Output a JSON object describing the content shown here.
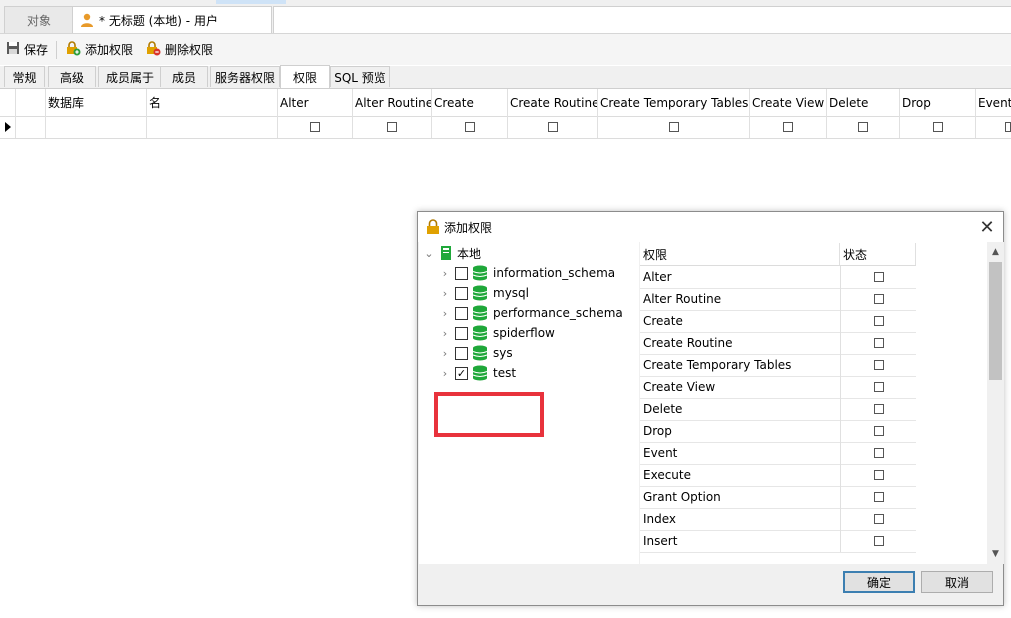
{
  "doc_tabs": [
    {
      "label": "对象"
    },
    {
      "label": "* 无标题 (本地) - 用户"
    }
  ],
  "toolbar": {
    "save_label": "保存",
    "add_priv_label": "添加权限",
    "del_priv_label": "删除权限"
  },
  "prop_tabs": [
    "常规",
    "高级",
    "成员属于",
    "成员",
    "服务器权限",
    "权限",
    "SQL 预览"
  ],
  "grid": {
    "headers": [
      "数据库",
      "名",
      "Alter",
      "Alter Routine",
      "Create",
      "Create Routine",
      "Create Temporary Tables",
      "Create View",
      "Delete",
      "Drop",
      "Event"
    ]
  },
  "dialog": {
    "title": "添加权限",
    "close_glyph": "✕",
    "tree_root": "本地",
    "databases": [
      {
        "name": "information_schema",
        "checked": false
      },
      {
        "name": "mysql",
        "checked": false
      },
      {
        "name": "performance_schema",
        "checked": false
      },
      {
        "name": "spiderflow",
        "checked": false
      },
      {
        "name": "sys",
        "checked": false
      },
      {
        "name": "test",
        "checked": true
      }
    ],
    "priv_header": "权限",
    "status_header": "状态",
    "privileges": [
      "Alter",
      "Alter Routine",
      "Create",
      "Create Routine",
      "Create Temporary Tables",
      "Create View",
      "Delete",
      "Drop",
      "Event",
      "Execute",
      "Grant Option",
      "Index",
      "Insert"
    ],
    "ok_label": "确定",
    "cancel_label": "取消"
  },
  "colors": {
    "db_icon": "#1fa83a",
    "highlight_box": "#e8323c",
    "lock": "#e0a100"
  }
}
